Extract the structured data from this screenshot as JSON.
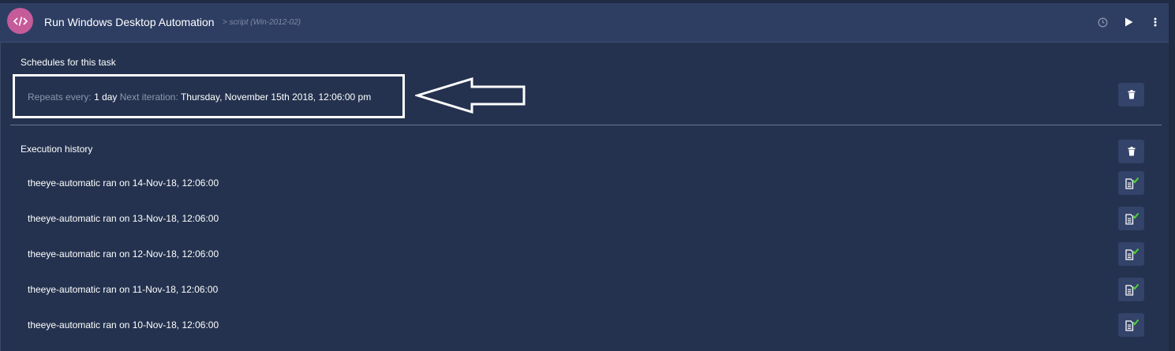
{
  "header": {
    "title": "Run Windows Desktop Automation",
    "subtitle": "> script (Win-2012-02)",
    "icons": [
      "code-icon",
      "clock-icon",
      "play-icon",
      "more-vertical-icon"
    ]
  },
  "schedules": {
    "heading": "Schedules for this task",
    "repeats_label": "Repeats every:",
    "repeats_value": "1 day",
    "next_label": "Next iteration:",
    "next_value": "Thursday, November 15th 2018, 12:06:00 pm"
  },
  "history": {
    "heading": "Execution history",
    "rows": [
      {
        "text": "theeye-automatic ran on 14-Nov-18, 12:06:00"
      },
      {
        "text": "theeye-automatic ran on 13-Nov-18, 12:06:00"
      },
      {
        "text": "theeye-automatic ran on 12-Nov-18, 12:06:00"
      },
      {
        "text": "theeye-automatic ran on 11-Nov-18, 12:06:00"
      },
      {
        "text": "theeye-automatic ran on 10-Nov-18, 12:06:00"
      }
    ]
  },
  "colors": {
    "background": "#24324f",
    "header": "#2e3e63",
    "task_icon": "#c65b9a",
    "button": "#33436a",
    "success_check": "#4cd137"
  }
}
